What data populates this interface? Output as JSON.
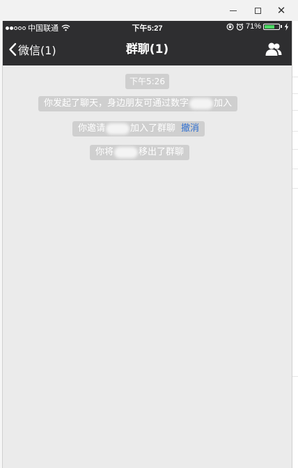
{
  "window": {
    "minimize_glyph": "",
    "maximize_glyph": "",
    "close_glyph": "✕"
  },
  "statusbar": {
    "carrier": "中国联通",
    "time": "下午5:27",
    "battery_percent": "71%",
    "battery_level": 0.71,
    "battery_color": "#4cd964"
  },
  "navbar": {
    "back_label": "微信(1)",
    "title": "群聊(1)",
    "people_icon": "group-members-icon"
  },
  "chat": {
    "timestamp": "下午5:26",
    "messages": [
      {
        "prefix": "你发起了聊天，身边朋友可通过数字",
        "suffix": "加入"
      },
      {
        "prefix": "你邀请",
        "suffix": "加入了群聊",
        "action": "撤消"
      },
      {
        "prefix": "你将",
        "suffix": "移出了群聊"
      }
    ]
  },
  "colors": {
    "navbar_bg": "#2e2e30",
    "chat_bg": "#ebebeb",
    "system_bubble_bg": "#cfcfcf",
    "link_color": "#2f6fd0"
  }
}
